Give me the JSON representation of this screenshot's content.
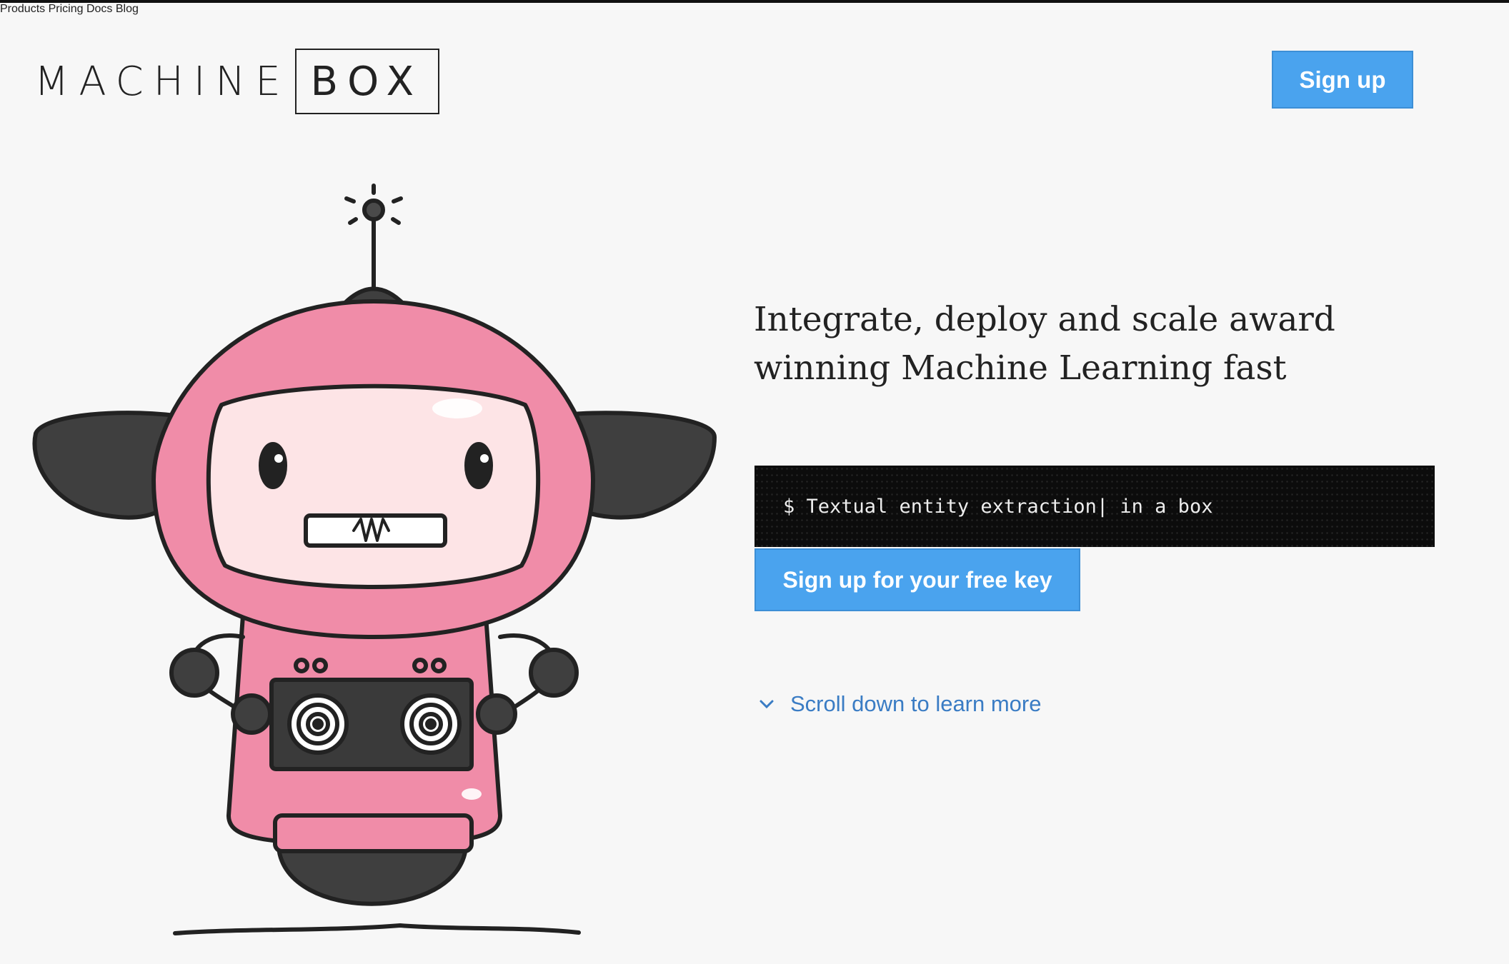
{
  "brand": {
    "part1": "MACHINE",
    "part2": "BOX"
  },
  "nav": {
    "items": [
      "Products",
      "Pricing",
      "Docs",
      "Blog"
    ],
    "signup_label": "Sign up"
  },
  "hero": {
    "title": "Integrate, deploy and scale award winning Machine Learning fast",
    "terminal_text": "$ Textual entity extraction| in a box",
    "cta_label": "Sign up for your free key",
    "scroll_label": "Scroll down to learn more"
  },
  "colors": {
    "accent": "#4aa3ee",
    "link": "#3a7cc4",
    "robot_pink": "#f08ca8",
    "terminal_bg": "#0c0c0c"
  },
  "icons": {
    "scroll": "chevron-down-icon",
    "mascot": "robot-mascot"
  }
}
